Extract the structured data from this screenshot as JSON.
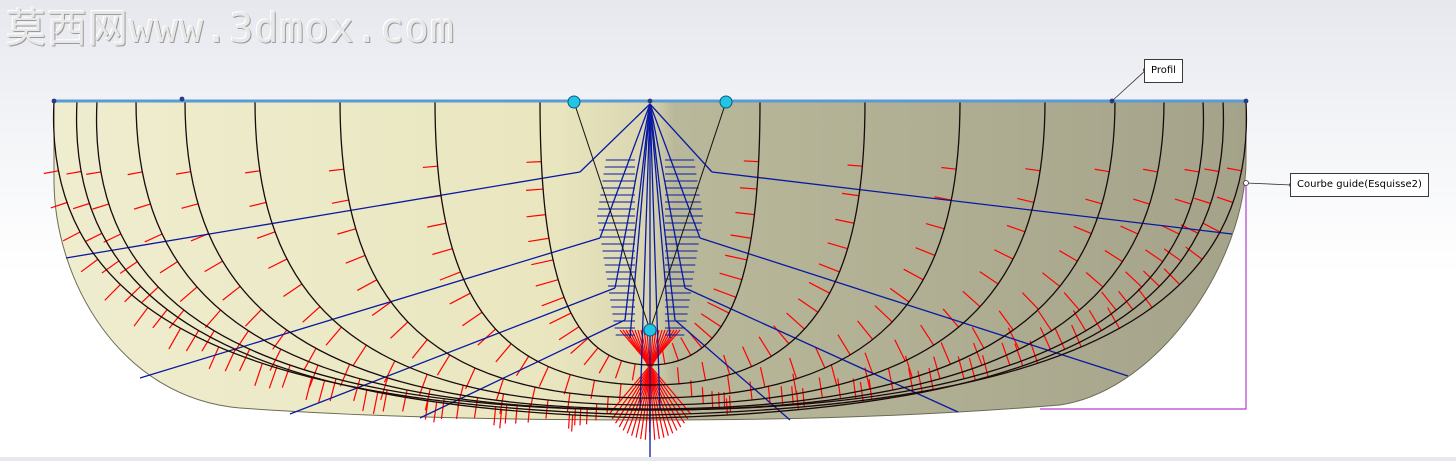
{
  "watermark": {
    "text": "莫西网www.3dmox.com"
  },
  "callouts": {
    "profile": "Profil",
    "guide_curve": "Courbe guide(Esquisse2)"
  },
  "colors": {
    "surface_left": "#e8e5c0",
    "surface_right": "#a9a78e",
    "profile_line": "#5b9bd5",
    "section_curves": "#1a0a0a",
    "curvature_combs": "#ff0000",
    "construction_lines": "#0a1aa0",
    "handles": "#22c4e8",
    "guide_bracket": "#b040d0"
  },
  "icons": {
    "handle": "filled-circle",
    "endpoint": "small-dot",
    "callout_anchor": "hollow-circle"
  }
}
